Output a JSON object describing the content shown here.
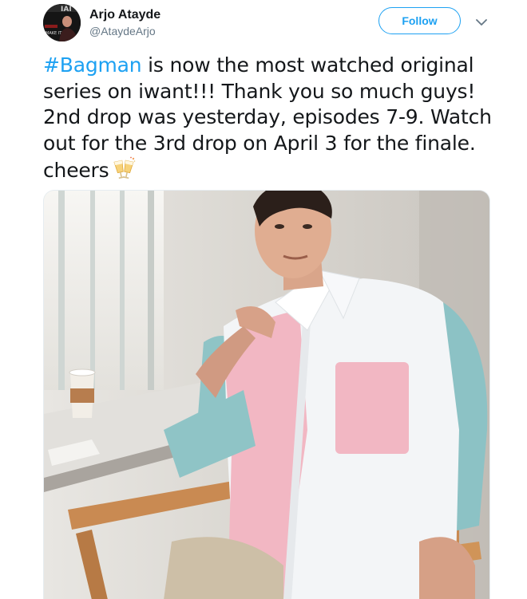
{
  "author": {
    "name": "Arjo Atayde",
    "handle": "@AtaydeArjo",
    "avatar_icon": "profile-photo"
  },
  "actions": {
    "follow_label": "Follow",
    "more_icon": "chevron-down-icon"
  },
  "tweet": {
    "hashtag": "#Bagman",
    "line1_rest": " is now the most watched original",
    "line2": "series on iwant!!! Thank you so much guys!",
    "line3": "2nd drop was yesterday, episodes 7-9. Watch",
    "line4": "out for the 3rd drop on April 3 for the finale.",
    "line5": "cheers",
    "emoji": "clinking-glasses-emoji"
  },
  "media": {
    "type": "photo",
    "content": "man in pink and light-blue button-down shirt sitting in wooden director chair"
  },
  "colors": {
    "accent": "#1da1f2",
    "text": "#14171a",
    "secondary": "#657786"
  }
}
